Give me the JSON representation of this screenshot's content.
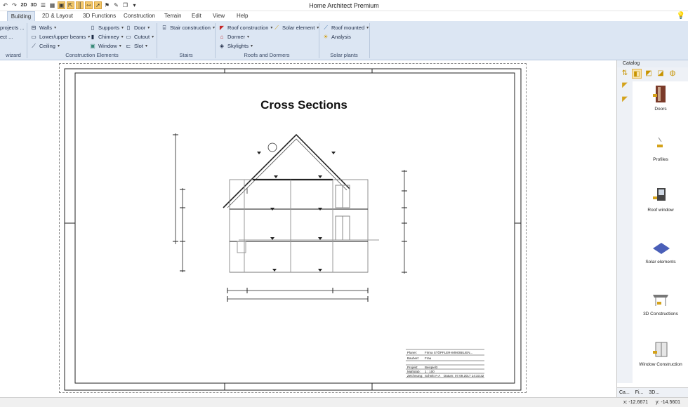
{
  "app_title": "Home Architect Premium",
  "menu_tabs": [
    "Building",
    "2D & Layout",
    "3D Functions",
    "Construction",
    "Terrain",
    "Edit",
    "View",
    "Help"
  ],
  "active_tab": "Building",
  "ribbon": {
    "wizard": {
      "items": [
        "projects ...",
        "ect ..."
      ],
      "label": "wizard"
    },
    "construction_elements": {
      "items": [
        "Walls",
        "Lower/upper beams",
        "Ceiling",
        "Supports",
        "Chimney",
        "Window",
        "Door",
        "Cutout",
        "Slot"
      ],
      "label": "Construction Elements"
    },
    "stairs": {
      "items": [
        "Stair construction"
      ],
      "label": "Stairs"
    },
    "roofs_dormers": {
      "items": [
        "Roof construction",
        "Solar element",
        "Dormer",
        "Skylights"
      ],
      "label": "Roofs and Dormers"
    },
    "solar_plants": {
      "items": [
        "Roof mounted",
        "Analysis"
      ],
      "label": "Solar plants"
    }
  },
  "drawing": {
    "title": "Cross Sections",
    "title_block": {
      "planer_label": "Planer:",
      "planer_value": "Firma STÖPFLER-IMMOBILIEN...",
      "bauherr_label": "Bauherr:",
      "bauherr_value": "Frau",
      "projekt_label": "Projekt:",
      "projekt_value": "Beispiel3",
      "massstab_label": "Maßstab:",
      "massstab_value": "1 : 100",
      "zeichnung_label": "Zeichnung:",
      "zeichnung_value": "Schnitt A-A",
      "datum_label": "Datum:",
      "datum_value": "07.09.2017 14:33:32"
    }
  },
  "catalog": {
    "header": "Catalog",
    "items": [
      "Doors",
      "Profiles",
      "Roof window",
      "Solar elements",
      "3D Constructions",
      "Window Construction"
    ],
    "bottom_tabs": [
      "Ca...",
      "Fi...",
      "3D..."
    ]
  },
  "status": {
    "x": "x: -12.6671",
    "y": "y: -14.5601"
  },
  "colors": {
    "ribbon_bg": "#dce6f3",
    "accent": "#f3c86b",
    "roof": "#c62828"
  }
}
